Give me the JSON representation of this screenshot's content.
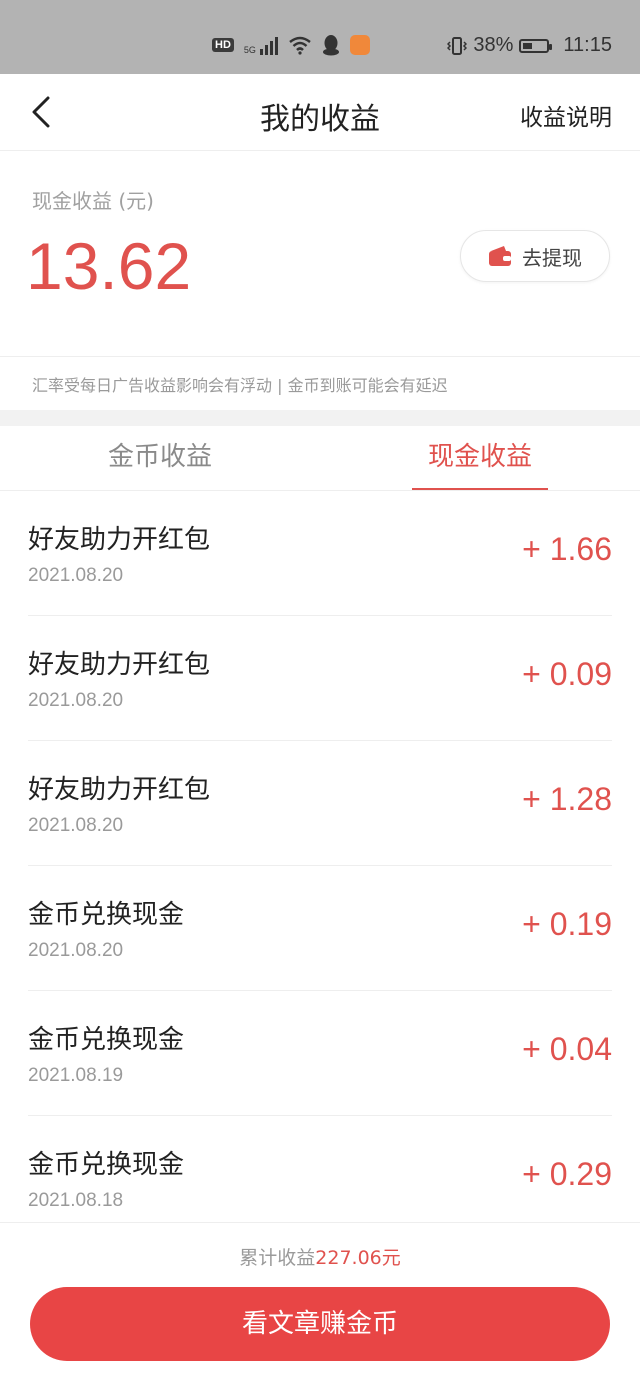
{
  "status_bar": {
    "hd": "HD",
    "network": "5G",
    "battery_percent": "38%",
    "time": "11:15"
  },
  "header": {
    "title": "我的收益",
    "help_link": "收益说明"
  },
  "balance": {
    "label": "现金收益 (元)",
    "value": "13.62",
    "withdraw_label": "去提现"
  },
  "notice": "汇率受每日广告收益影响会有浮动 | 金币到账可能会有延迟",
  "tabs": {
    "coins": "金币收益",
    "cash": "现金收益",
    "active": "cash"
  },
  "records": [
    {
      "title": "好友助力开红包",
      "date": "2021.08.20",
      "amount": "+ 1.66"
    },
    {
      "title": "好友助力开红包",
      "date": "2021.08.20",
      "amount": "+ 0.09"
    },
    {
      "title": "好友助力开红包",
      "date": "2021.08.20",
      "amount": "+ 1.28"
    },
    {
      "title": "金币兑换现金",
      "date": "2021.08.20",
      "amount": "+ 0.19"
    },
    {
      "title": "金币兑换现金",
      "date": "2021.08.19",
      "amount": "+ 0.04"
    },
    {
      "title": "金币兑换现金",
      "date": "2021.08.18",
      "amount": "+ 0.29"
    }
  ],
  "footer": {
    "total_label": "累计收益",
    "total_amount": "227.06元",
    "cta_label": "看文章赚金币"
  },
  "colors": {
    "accent": "#e0524e",
    "cta_background": "#e84545",
    "status_bar": "#b3b3b3"
  }
}
